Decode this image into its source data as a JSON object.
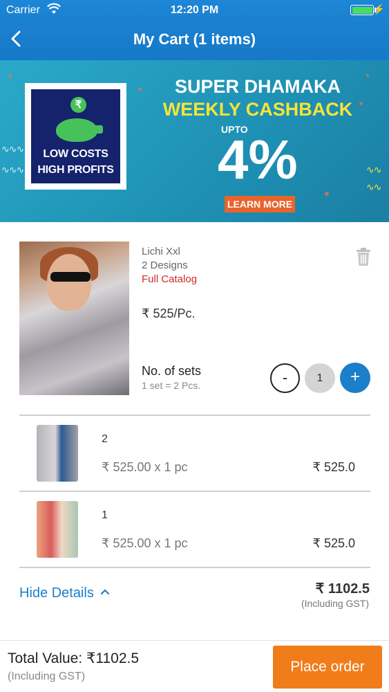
{
  "status_bar": {
    "carrier": "Carrier",
    "time": "12:20 PM"
  },
  "nav": {
    "title": "My Cart (1 items)"
  },
  "banner": {
    "logo_text_line1": "LOW COSTS",
    "logo_text_line2": "HIGH PROFITS",
    "headline": "SUPER DHAMAKA",
    "subheadline": "WEEKLY CASHBACK",
    "upto": "UPTO",
    "percent": "4%",
    "cta": "LEARN MORE"
  },
  "product": {
    "name": "Lichi Xxl",
    "designs": "2 Designs",
    "catalog": "Full Catalog",
    "price": "₹ 525/Pc.",
    "sets_label": "No. of sets",
    "set_size": "1 set = 2 Pcs.",
    "quantity": "1"
  },
  "designs": [
    {
      "number": "2",
      "calc": "₹ 525.00 x 1 pc",
      "total": "₹ 525.0"
    },
    {
      "number": "1",
      "calc": "₹ 525.00 x 1 pc",
      "total": "₹ 525.0"
    }
  ],
  "summary": {
    "toggle_label": "Hide Details",
    "total": "₹ 1102.5",
    "gst_note": "(Including GST)"
  },
  "footer": {
    "total_label": "Total Value: ₹1102.5",
    "gst_note": "(Including GST)",
    "cta": "Place order"
  },
  "colors": {
    "header": "#1679c7",
    "accent_blue": "#1b7fc9",
    "catalog_red": "#d22a2a",
    "cta_orange": "#f07c1a"
  }
}
